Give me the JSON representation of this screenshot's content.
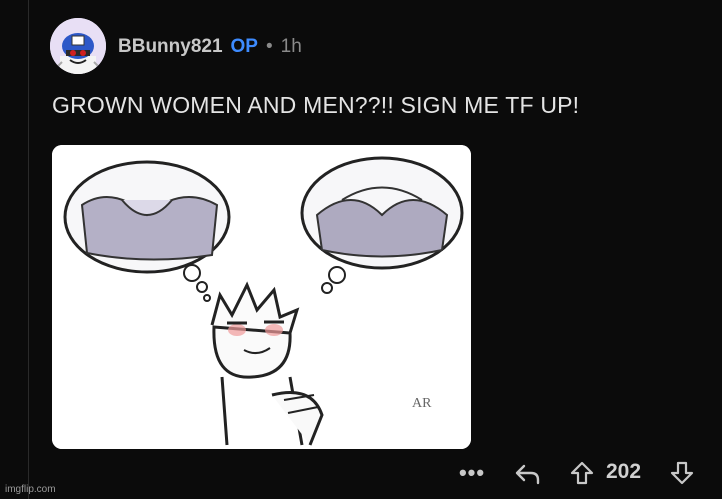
{
  "comment": {
    "username": "BBunny821",
    "op_badge": "OP",
    "separator": "•",
    "time": "1h",
    "text": "GROWN WOMEN AND MEN??!! SIGN ME TF UP!",
    "image_signature": "AR"
  },
  "actions": {
    "more_label": "•••",
    "score": "202"
  },
  "watermark": "imgflip.com",
  "colors": {
    "background": "#0b0b0b",
    "op_badge": "#3d8bff",
    "text": "#e4e4e4"
  }
}
